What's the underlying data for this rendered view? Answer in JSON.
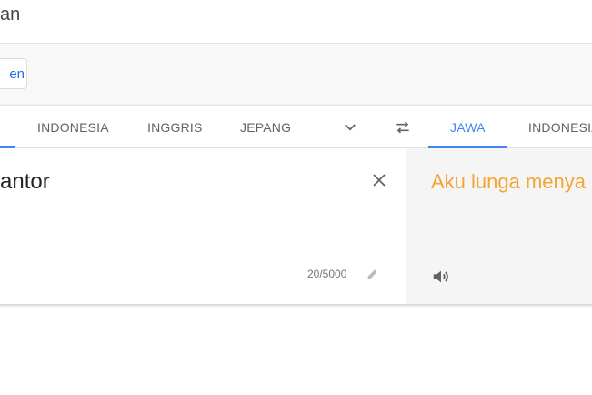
{
  "header": {
    "title_fragment": "an"
  },
  "toolbar": {
    "documents_button_fragment": "en"
  },
  "languages": {
    "source_tabs": [
      "INDONESIA",
      "INGGRIS",
      "JEPANG"
    ],
    "target_tabs": [
      "JAWA",
      "INDONESIA"
    ]
  },
  "source": {
    "text_fragment": "antor",
    "char_count": "20/5000"
  },
  "target": {
    "text_fragment": "Aku lunga menya"
  },
  "icons": {
    "more_languages": "chevron-down-icon",
    "swap": "swap-languages-icon",
    "clear": "close-icon",
    "edit": "pencil-icon",
    "listen": "speaker-icon"
  },
  "colors": {
    "accent": "#4285f4",
    "translation_text": "#f4a433",
    "target_panel_bg": "#f5f5f5"
  }
}
